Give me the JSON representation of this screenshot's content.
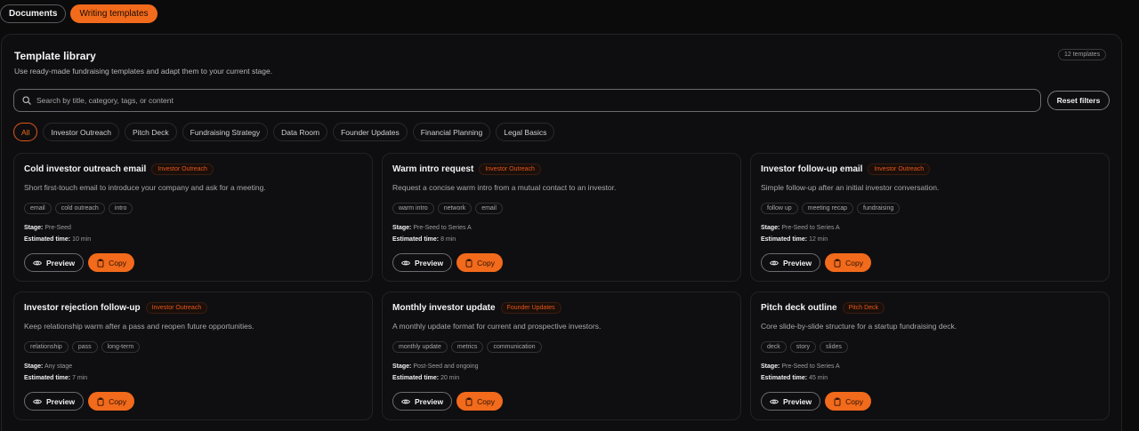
{
  "top_tabs": [
    {
      "label": "Documents",
      "active": false
    },
    {
      "label": "Writing templates",
      "active": true
    }
  ],
  "library": {
    "title": "Template library",
    "subtitle": "Use ready-made fundraising templates and adapt them to your current stage.",
    "count_badge": "12 templates"
  },
  "search": {
    "placeholder": "Search by title, category, tags, or content",
    "value": ""
  },
  "reset_label": "Reset filters",
  "filters": [
    {
      "label": "All",
      "active": true
    },
    {
      "label": "Investor Outreach",
      "active": false
    },
    {
      "label": "Pitch Deck",
      "active": false
    },
    {
      "label": "Fundraising Strategy",
      "active": false
    },
    {
      "label": "Data Room",
      "active": false
    },
    {
      "label": "Founder Updates",
      "active": false
    },
    {
      "label": "Financial Planning",
      "active": false
    },
    {
      "label": "Legal Basics",
      "active": false
    }
  ],
  "labels": {
    "stage": "Stage:",
    "time": "Estimated time:",
    "preview": "Preview",
    "copy": "Copy"
  },
  "icons": {
    "search": "search-icon",
    "preview": "eye-icon",
    "copy": "clipboard-icon"
  },
  "colors": {
    "accent": "#f26a1b",
    "background": "#0b0b0c"
  },
  "templates": [
    {
      "title": "Cold investor outreach email",
      "category": "Investor Outreach",
      "description": "Short first-touch email to introduce your company and ask for a meeting.",
      "tags": [
        "email",
        "cold outreach",
        "intro"
      ],
      "stage": "Pre-Seed",
      "time": "10 min"
    },
    {
      "title": "Warm intro request",
      "category": "Investor Outreach",
      "description": "Request a concise warm intro from a mutual contact to an investor.",
      "tags": [
        "warm intro",
        "network",
        "email"
      ],
      "stage": "Pre-Seed to Series A",
      "time": "8 min"
    },
    {
      "title": "Investor follow-up email",
      "category": "Investor Outreach",
      "description": "Simple follow-up after an initial investor conversation.",
      "tags": [
        "follow up",
        "meeting recap",
        "fundraising"
      ],
      "stage": "Pre-Seed to Series A",
      "time": "12 min"
    },
    {
      "title": "Investor rejection follow-up",
      "category": "Investor Outreach",
      "description": "Keep relationship warm after a pass and reopen future opportunities.",
      "tags": [
        "relationship",
        "pass",
        "long-term"
      ],
      "stage": "Any stage",
      "time": "7 min"
    },
    {
      "title": "Monthly investor update",
      "category": "Founder Updates",
      "description": "A monthly update format for current and prospective investors.",
      "tags": [
        "monthly update",
        "metrics",
        "communication"
      ],
      "stage": "Post-Seed and ongoing",
      "time": "20 min"
    },
    {
      "title": "Pitch deck outline",
      "category": "Pitch Deck",
      "description": "Core slide-by-slide structure for a startup fundraising deck.",
      "tags": [
        "deck",
        "story",
        "slides"
      ],
      "stage": "Pre-Seed to Series A",
      "time": "45 min"
    }
  ]
}
